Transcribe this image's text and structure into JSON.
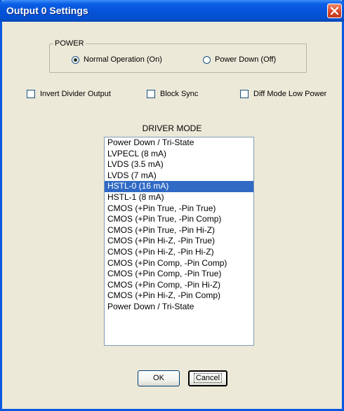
{
  "window": {
    "title": "Output 0 Settings"
  },
  "power": {
    "legend": "POWER",
    "options": [
      {
        "label": "Normal Operation (On)",
        "selected": true
      },
      {
        "label": "Power Down (Off)",
        "selected": false
      }
    ]
  },
  "checkboxes": [
    {
      "label": "Invert Divider Output",
      "checked": false
    },
    {
      "label": "Block Sync",
      "checked": false
    },
    {
      "label": "Diff Mode Low Power",
      "checked": false
    }
  ],
  "driver_mode": {
    "label": "DRIVER MODE",
    "selected": "HSTL-0 (16 mA)",
    "items": [
      "Power Down / Tri-State",
      "LVPECL (8 mA)",
      "LVDS (3.5 mA)",
      "LVDS (7 mA)",
      "HSTL-0 (16 mA)",
      "HSTL-1 (8 mA)",
      "CMOS (+Pin True, -Pin True)",
      "CMOS (+Pin True, -Pin Comp)",
      "CMOS (+Pin True, -Pin Hi-Z)",
      "CMOS (+Pin Hi-Z, -Pin True)",
      "CMOS (+Pin Hi-Z, -Pin Hi-Z)",
      "CMOS (+Pin Comp, -Pin Comp)",
      "CMOS (+Pin Comp, -Pin True)",
      "CMOS (+Pin Comp, -Pin Hi-Z)",
      "CMOS (+Pin Hi-Z, -Pin Comp)",
      "Power Down / Tri-State"
    ]
  },
  "buttons": {
    "ok": "OK",
    "cancel": "Cancel"
  },
  "colors": {
    "titlebar": "#0552d8",
    "selection": "#316ac5",
    "dialog_bg": "#ece9d8"
  }
}
